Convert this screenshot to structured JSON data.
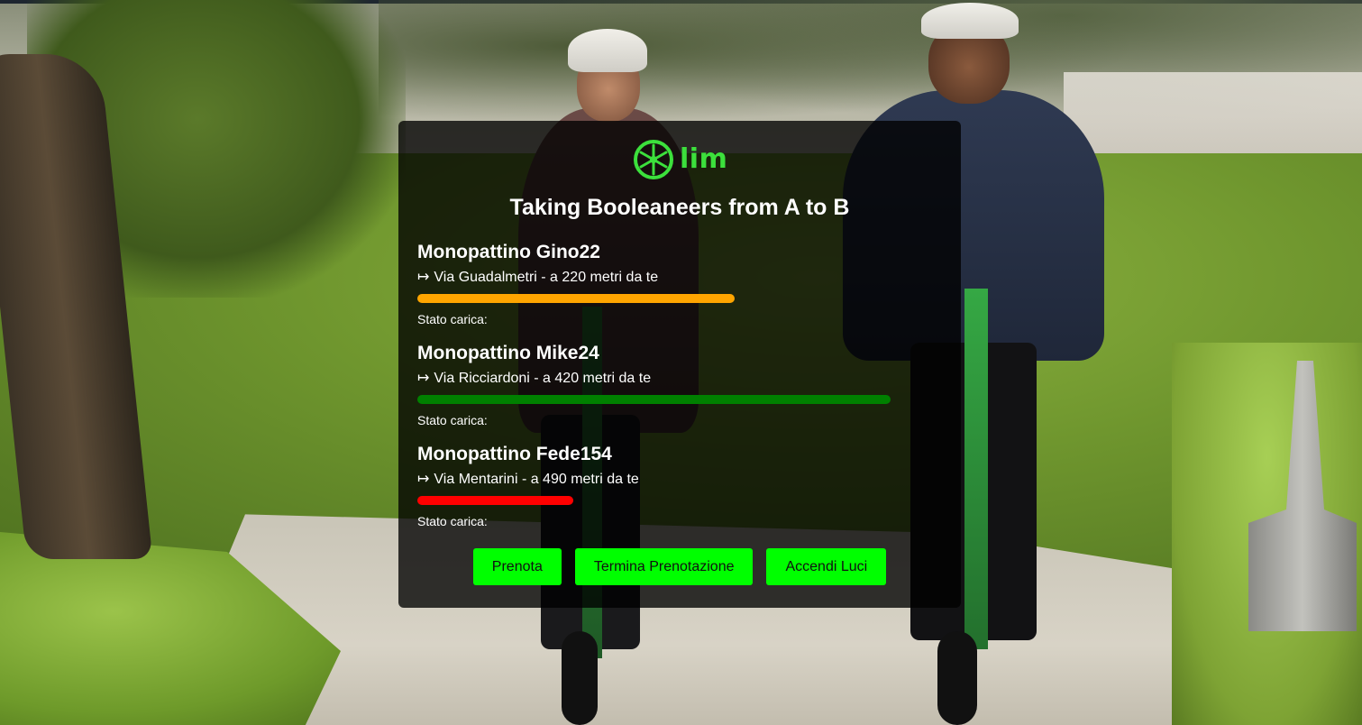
{
  "brand": {
    "logo_text": "lim",
    "tagline": "Taking Booleaneers from A to B",
    "accent_color": "#00ff00"
  },
  "scooters": [
    {
      "name": "Monopattino Gino22",
      "arrow": "↦",
      "location": "Via Guadalmetri - a 220 metri da te",
      "battery_label": "Stato carica:",
      "battery_level": 0.67,
      "battery_color": "#ffa500"
    },
    {
      "name": "Monopattino Mike24",
      "arrow": "↦",
      "location": "Via Ricciardoni - a 420 metri da te",
      "battery_label": "Stato carica:",
      "battery_level": 1.0,
      "battery_color": "#008000"
    },
    {
      "name": "Monopattino Fede154",
      "arrow": "↦",
      "location": "Via Mentarini - a 490 metri da te",
      "battery_label": "Stato carica:",
      "battery_level": 0.33,
      "battery_color": "#ff0000"
    }
  ],
  "actions": {
    "book_label": "Prenota",
    "end_booking_label": "Termina Prenotazione",
    "lights_label": "Accendi Luci"
  }
}
